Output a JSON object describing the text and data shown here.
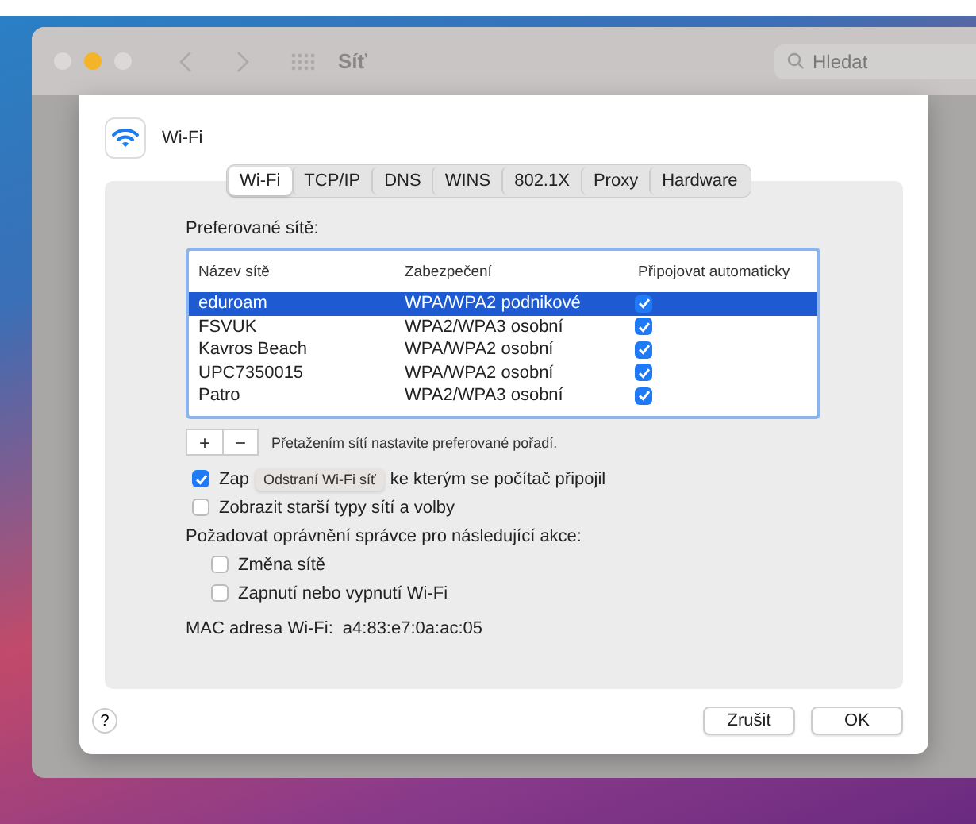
{
  "window": {
    "title": "Síť",
    "search": {
      "placeholder": "Hledat"
    }
  },
  "sheet": {
    "title": "Wi-Fi",
    "tabs": [
      {
        "label": "Wi-Fi",
        "selected": true
      },
      {
        "label": "TCP/IP",
        "selected": false
      },
      {
        "label": "DNS",
        "selected": false
      },
      {
        "label": "WINS",
        "selected": false
      },
      {
        "label": "802.1X",
        "selected": false
      },
      {
        "label": "Proxy",
        "selected": false
      },
      {
        "label": "Hardware",
        "selected": false
      }
    ],
    "preferred_label": "Preferované sítě:",
    "table": {
      "columns": [
        "Název sítě",
        "Zabezpečení",
        "Připojovat automaticky"
      ],
      "rows": [
        {
          "name": "eduroam",
          "security": "WPA/WPA2 podnikové",
          "auto": true,
          "selected": true
        },
        {
          "name": "FSVUK",
          "security": "WPA2/WPA3 osobní",
          "auto": true,
          "selected": false
        },
        {
          "name": "Kavros Beach",
          "security": "WPA/WPA2 osobní",
          "auto": true,
          "selected": false
        },
        {
          "name": "UPC7350015",
          "security": "WPA/WPA2 osobní",
          "auto": true,
          "selected": false
        },
        {
          "name": "Patro",
          "security": "WPA2/WPA3 osobní",
          "auto": true,
          "selected": false
        }
      ]
    },
    "add_button": "+",
    "remove_button": "−",
    "hint": "Přetažením sítí nastavite preferované pořadí.",
    "options": [
      {
        "label_start": "Zap",
        "label_end": "ke kterým se počítač připojil",
        "checked": true,
        "tooltip": "Odstraní Wi-Fi síť"
      },
      {
        "label_start": "Zobrazit starší typy sítí a volby",
        "checked": false
      }
    ],
    "admin_label": "Požadovat oprávnění správce pro následující akce:",
    "admin_options": [
      {
        "label": "Změna sítě",
        "checked": false
      },
      {
        "label": "Zapnutí nebo vypnutí Wi-Fi",
        "checked": false
      }
    ],
    "mac_label": "MAC adresa Wi-Fi:",
    "mac_value": "a4:83:e7:0a:ac:05",
    "help": "?",
    "buttons": [
      {
        "label": "Zrušit",
        "kind": "cancel"
      },
      {
        "label": "OK",
        "kind": "ok"
      }
    ]
  }
}
